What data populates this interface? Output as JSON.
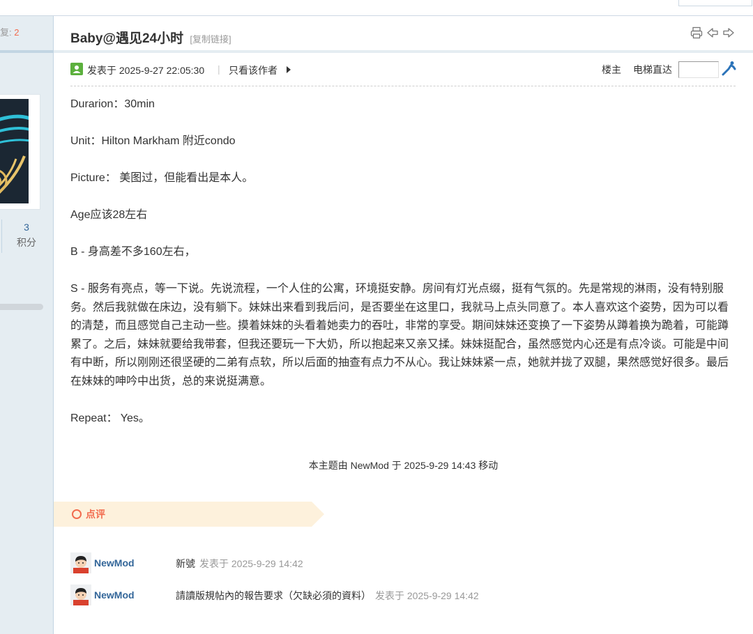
{
  "sidebar": {
    "reply_label": "复:",
    "reply_count": "2",
    "credit_value": "3",
    "credit_label": "积分"
  },
  "thread": {
    "title": "Baby@遇见24小时",
    "copy_link": "[复制链接]"
  },
  "post": {
    "posted_at": "发表于 2025-9-27 22:05:30",
    "separator": "|",
    "author_only": "只看该作者",
    "floor_label": "楼主",
    "elevator_label": "电梯直达",
    "elevator_value": "",
    "body": [
      "Durarion：30min",
      "Unit：Hilton Markham 附近condo",
      "Picture： 美图过，但能看出是本人。",
      "Age应该28左右",
      "B - 身高差不多160左右，",
      "S - 服务有亮点，等一下说。先说流程，一个人住的公寓，环境挺安静。房间有灯光点缀，挺有气氛的。先是常规的淋雨，没有特别服务。然后我就做在床边，没有躺下。妹妹出来看到我后问，是否要坐在这里口，我就马上点头同意了。本人喜欢这个姿势，因为可以看的清楚，而且感觉自己主动一些。摸着妹妹的头看着她卖力的吞吐，非常的享受。期间妹妹还变换了一下姿势从蹲着换为跪着，可能蹲累了。之后，妹妹就要给我带套，但我还要玩一下大奶，所以抱起来又亲又揉。妹妹挺配合，虽然感觉内心还是有点冷谈。可能是中间有中断，所以刚刚还很坚硬的二弟有点软，所以后面的抽查有点力不从心。我让妹妹紧一点，她就并拢了双腿，果然感觉好很多。最后在妹妹的呻吟中出货，总的来说挺满意。",
      "Repeat： Yes。"
    ],
    "moved_notice": "本主题由 NewMod 于 2025-9-29 14:43 移动"
  },
  "comments": {
    "header": "点评",
    "items": [
      {
        "user": "NewMod",
        "text": "新號",
        "time": "发表于 2025-9-29 14:42"
      },
      {
        "user": "NewMod",
        "text": "請讀版規帖內的報告要求（欠缺必須的資料）",
        "time": "发表于 2025-9-29 14:42"
      }
    ]
  },
  "colors": {
    "accent": "#f26c4f",
    "link": "#336699",
    "sidebar_bg": "#e5edf2",
    "comment_header_bg": "#fdf1dc",
    "online_green": "#5cb03d"
  },
  "icons": [
    "print-icon",
    "previous-thread-icon",
    "next-thread-icon",
    "online-status-icon",
    "elevator-go-icon",
    "user-avatar-icon"
  ]
}
